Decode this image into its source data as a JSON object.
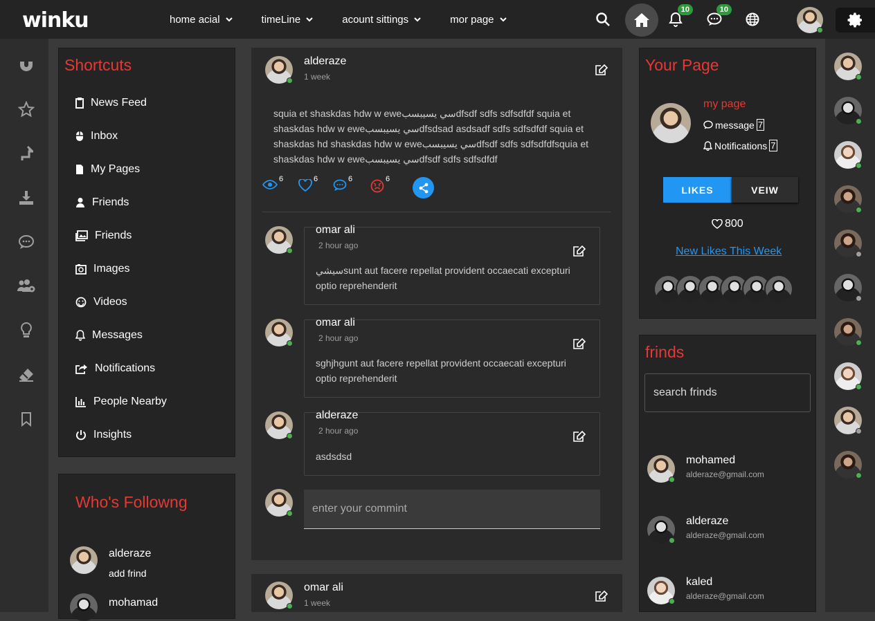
{
  "brand": {
    "logo": "winku"
  },
  "topnav": [
    {
      "label": "home acial"
    },
    {
      "label": "timeLine"
    },
    {
      "label": "acount sittings"
    },
    {
      "label": "mor page"
    }
  ],
  "top_icons": {
    "notifications_count": "10",
    "messages_count": "10"
  },
  "left_rail": [
    "magnet-icon",
    "star-icon",
    "share-arrow-icon",
    "download-icon",
    "chat-icon",
    "users-settings-icon",
    "lightbulb-icon",
    "eraser-icon",
    "bookmark-icon"
  ],
  "shortcuts": {
    "title": "Shortcuts",
    "items": [
      {
        "label": "News Feed",
        "icon": "clipboard-icon"
      },
      {
        "label": "Inbox",
        "icon": "mouse-icon"
      },
      {
        "label": "My Pages",
        "icon": "file-icon"
      },
      {
        "label": "Friends",
        "icon": "user-icon"
      },
      {
        "label": "Friends",
        "icon": "images-icon"
      },
      {
        "label": "Images",
        "icon": "camera-icon"
      },
      {
        "label": "Videos",
        "icon": "smile-icon"
      },
      {
        "label": "Messages",
        "icon": "bell-icon"
      },
      {
        "label": "Notifications",
        "icon": "share-square-icon"
      },
      {
        "label": "People Nearby",
        "icon": "bar-chart-icon"
      },
      {
        "label": "Insights",
        "icon": "power-icon"
      }
    ]
  },
  "following": {
    "title": "Who's Followng",
    "items": [
      {
        "name": "alderaze",
        "action": "add frind"
      },
      {
        "name": "mohamad",
        "action": ""
      }
    ]
  },
  "post": {
    "author": "alderaze",
    "time": "1 week",
    "text": "squia et shaskdas hdw w eweسي يسيبسبdfsdf sdfs sdfsdfdf squia et shaskdas hdw w eweسي يسيبسبdfsdsad asdsadf sdfs sdfsdfdf squia et shaskdas hd shaskdas hdw w eweسي يسيبسبdfsdf sdfs sdfsdfdfsquia et shaskdas hdw w eweسي يسيبسبdfsdf sdfs sdfsdfdf",
    "reactions": {
      "views": "6",
      "likes": "6",
      "comments": "6",
      "angry": "6"
    },
    "comments": [
      {
        "name": "omar ali",
        "time": "2 hour ago",
        "text": "سيشيsunt aut facere repellat provident occaecati excepturi optio reprehenderit"
      },
      {
        "name": "omar ali",
        "time": "2 hour ago",
        "text": "sghjhgunt aut facere repellat provident occaecati excepturi optio reprehenderit"
      },
      {
        "name": "alderaze",
        "time": "2 hour ago",
        "text": "asdsdsd"
      }
    ],
    "comment_placeholder": "enter your commint"
  },
  "post2": {
    "author": "omar ali",
    "time": "1 week"
  },
  "your_page": {
    "title": "Your Page",
    "page_link": "my page",
    "message_label": "message",
    "message_count": "7",
    "notif_label": "Notifications",
    "notif_count": "7",
    "likes_btn": "LIKES",
    "view_btn": "VEIW",
    "like_count": "800",
    "new_likes": "New Likes This Week"
  },
  "friends": {
    "title": "frinds",
    "search_placeholder": "search frinds",
    "items": [
      {
        "name": "mohamed",
        "email": "alderaze@gmail.com"
      },
      {
        "name": "alderaze",
        "email": "alderaze@gmail.com"
      },
      {
        "name": "kaled",
        "email": "alderaze@gmail.com"
      }
    ]
  },
  "colors": {
    "accent": "#e53935",
    "primary": "#2196f3",
    "online": "#4caf50",
    "badge": "#2e9a3c"
  }
}
